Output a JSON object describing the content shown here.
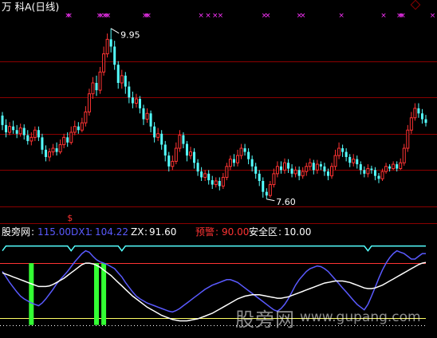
{
  "chart_data": [
    {
      "type": "candlestick",
      "title": "万 科A(日线)",
      "y_range": [
        7.4,
        10.1
      ],
      "annotations": {
        "high_label": "9.95",
        "low_label": "7.60",
        "signal_glyph": "$"
      },
      "colors": {
        "up": "#ff3333",
        "down": "#54ffff",
        "gridline": "#8b0000",
        "marker_x": "#ff33ff",
        "label_white": "#ffffff"
      },
      "candles": [
        [
          8.75,
          8.62,
          8.8,
          8.55
        ],
        [
          8.62,
          8.52,
          8.7,
          8.45
        ],
        [
          8.52,
          8.6,
          8.66,
          8.48
        ],
        [
          8.6,
          8.55,
          8.68,
          8.5
        ],
        [
          8.55,
          8.5,
          8.62,
          8.44
        ],
        [
          8.5,
          8.58,
          8.64,
          8.46
        ],
        [
          8.58,
          8.48,
          8.63,
          8.42
        ],
        [
          8.48,
          8.4,
          8.55,
          8.35
        ],
        [
          8.4,
          8.45,
          8.52,
          8.34
        ],
        [
          8.45,
          8.55,
          8.6,
          8.4
        ],
        [
          8.55,
          8.45,
          8.6,
          8.4
        ],
        [
          8.45,
          8.28,
          8.5,
          8.22
        ],
        [
          8.28,
          8.18,
          8.34,
          8.12
        ],
        [
          8.18,
          8.25,
          8.3,
          8.12
        ],
        [
          8.25,
          8.3,
          8.36,
          8.2
        ],
        [
          8.3,
          8.25,
          8.38,
          8.2
        ],
        [
          8.25,
          8.35,
          8.42,
          8.22
        ],
        [
          8.35,
          8.45,
          8.5,
          8.3
        ],
        [
          8.45,
          8.38,
          8.52,
          8.32
        ],
        [
          8.38,
          8.52,
          8.6,
          8.35
        ],
        [
          8.52,
          8.6,
          8.68,
          8.48
        ],
        [
          8.6,
          8.55,
          8.66,
          8.5
        ],
        [
          8.55,
          8.65,
          8.72,
          8.52
        ],
        [
          8.65,
          8.8,
          8.88,
          8.6
        ],
        [
          8.8,
          9.05,
          9.12,
          8.75
        ],
        [
          9.05,
          9.2,
          9.28,
          8.98
        ],
        [
          9.2,
          9.1,
          9.3,
          9.02
        ],
        [
          9.1,
          9.35,
          9.42,
          9.05
        ],
        [
          9.35,
          9.6,
          9.7,
          9.3
        ],
        [
          9.6,
          9.8,
          9.88,
          9.55
        ],
        [
          9.8,
          9.7,
          9.95,
          9.62
        ],
        [
          9.7,
          9.45,
          9.78,
          9.38
        ],
        [
          9.45,
          9.2,
          9.5,
          9.12
        ],
        [
          9.2,
          9.3,
          9.38,
          9.12
        ],
        [
          9.3,
          9.15,
          9.35,
          9.05
        ],
        [
          9.15,
          9.0,
          9.22,
          8.92
        ],
        [
          9.0,
          8.92,
          9.08,
          8.85
        ],
        [
          8.92,
          8.98,
          9.05,
          8.86
        ],
        [
          8.98,
          8.85,
          9.02,
          8.78
        ],
        [
          8.85,
          8.7,
          8.9,
          8.62
        ],
        [
          8.7,
          8.78,
          8.85,
          8.65
        ],
        [
          8.78,
          8.6,
          8.82,
          8.52
        ],
        [
          8.6,
          8.45,
          8.66,
          8.38
        ],
        [
          8.45,
          8.5,
          8.58,
          8.4
        ],
        [
          8.5,
          8.35,
          8.55,
          8.28
        ],
        [
          8.35,
          8.2,
          8.4,
          8.12
        ],
        [
          8.2,
          8.05,
          8.25,
          7.98
        ],
        [
          8.05,
          8.12,
          8.2,
          8.0
        ],
        [
          8.12,
          8.3,
          8.38,
          8.08
        ],
        [
          8.3,
          8.48,
          8.55,
          8.25
        ],
        [
          8.48,
          8.36,
          8.52,
          8.3
        ],
        [
          8.36,
          8.2,
          8.4,
          8.12
        ],
        [
          8.2,
          8.25,
          8.32,
          8.15
        ],
        [
          8.25,
          8.1,
          8.3,
          8.02
        ],
        [
          8.1,
          7.98,
          8.15,
          7.92
        ],
        [
          7.98,
          7.9,
          8.04,
          7.85
        ],
        [
          7.9,
          7.95,
          8.0,
          7.85
        ],
        [
          7.95,
          7.86,
          8.0,
          7.8
        ],
        [
          7.86,
          7.8,
          7.92,
          7.74
        ],
        [
          7.8,
          7.85,
          7.9,
          7.76
        ],
        [
          7.85,
          7.78,
          7.9,
          7.72
        ],
        [
          7.78,
          7.9,
          7.96,
          7.74
        ],
        [
          7.9,
          8.05,
          8.1,
          7.86
        ],
        [
          8.05,
          8.15,
          8.2,
          8.0
        ],
        [
          8.15,
          8.1,
          8.22,
          8.05
        ],
        [
          8.1,
          8.2,
          8.28,
          8.05
        ],
        [
          8.2,
          8.3,
          8.36,
          8.15
        ],
        [
          8.3,
          8.25,
          8.36,
          8.2
        ],
        [
          8.25,
          8.15,
          8.3,
          8.08
        ],
        [
          8.15,
          8.05,
          8.2,
          7.98
        ],
        [
          8.05,
          7.95,
          8.1,
          7.88
        ],
        [
          7.95,
          7.85,
          8.0,
          7.78
        ],
        [
          7.85,
          7.7,
          7.9,
          7.62
        ],
        [
          7.7,
          7.65,
          7.75,
          7.6
        ],
        [
          7.65,
          7.8,
          7.85,
          7.62
        ],
        [
          7.8,
          7.95,
          8.02,
          7.76
        ],
        [
          7.95,
          8.05,
          8.12,
          7.9
        ],
        [
          8.05,
          8.0,
          8.12,
          7.95
        ],
        [
          8.0,
          8.1,
          8.16,
          7.95
        ],
        [
          8.1,
          8.02,
          8.15,
          7.96
        ],
        [
          8.02,
          7.95,
          8.08,
          7.9
        ],
        [
          7.95,
          8.0,
          8.05,
          7.9
        ],
        [
          8.0,
          7.92,
          8.05,
          7.86
        ],
        [
          7.92,
          7.98,
          8.04,
          7.88
        ],
        [
          7.98,
          8.05,
          8.1,
          7.92
        ],
        [
          8.05,
          8.1,
          8.16,
          8.0
        ],
        [
          8.1,
          8.0,
          8.14,
          7.94
        ],
        [
          8.0,
          8.08,
          8.14,
          7.95
        ],
        [
          8.08,
          8.05,
          8.12,
          8.0
        ],
        [
          8.05,
          7.98,
          8.1,
          7.92
        ],
        [
          7.98,
          7.92,
          8.02,
          7.86
        ],
        [
          7.92,
          8.05,
          8.1,
          7.88
        ],
        [
          8.05,
          8.2,
          8.28,
          8.0
        ],
        [
          8.2,
          8.3,
          8.38,
          8.15
        ],
        [
          8.3,
          8.25,
          8.35,
          8.18
        ],
        [
          8.25,
          8.18,
          8.3,
          8.12
        ],
        [
          8.18,
          8.1,
          8.22,
          8.04
        ],
        [
          8.1,
          8.15,
          8.22,
          8.05
        ],
        [
          8.15,
          8.08,
          8.2,
          8.02
        ],
        [
          8.08,
          8.0,
          8.12,
          7.94
        ],
        [
          8.0,
          7.95,
          8.05,
          7.9
        ],
        [
          7.95,
          8.02,
          8.08,
          7.9
        ],
        [
          8.02,
          8.0,
          8.06,
          7.95
        ],
        [
          8.0,
          7.92,
          8.04,
          7.86
        ],
        [
          7.92,
          7.88,
          7.96,
          7.82
        ],
        [
          7.88,
          7.98,
          8.02,
          7.85
        ],
        [
          7.98,
          8.05,
          8.1,
          7.95
        ],
        [
          8.05,
          8.02,
          8.08,
          7.98
        ],
        [
          8.02,
          8.08,
          8.12,
          8.0
        ],
        [
          8.08,
          8.02,
          8.12,
          7.98
        ],
        [
          8.02,
          8.1,
          8.16,
          8.0
        ],
        [
          8.1,
          8.3,
          8.36,
          8.06
        ],
        [
          8.3,
          8.55,
          8.62,
          8.25
        ],
        [
          8.55,
          8.72,
          8.8,
          8.5
        ],
        [
          8.72,
          8.85,
          8.92,
          8.68
        ],
        [
          8.85,
          8.78,
          8.92,
          8.72
        ],
        [
          8.78,
          8.7,
          8.84,
          8.64
        ],
        [
          8.7,
          8.65,
          8.76,
          8.6
        ]
      ]
    },
    {
      "type": "line",
      "y_range": [
        -12,
        125
      ],
      "legend": [
        {
          "name": "股旁网",
          "value": "115.00",
          "color": "#ffffff"
        },
        {
          "name": "DX1",
          "value": "104.22",
          "color": "#5a5aff"
        },
        {
          "name": "ZX",
          "value": "91.60",
          "color": "#ffffff"
        },
        {
          "name": "预警",
          "value": "90.00",
          "color": "#ff3333"
        },
        {
          "name": "安全区",
          "value": "10.00",
          "color": "#ffffff"
        }
      ],
      "reference_lines": [
        {
          "name": "股旁网",
          "value": 115,
          "color": "#54ffff"
        },
        {
          "name": "预警",
          "value": 90,
          "color": "#ff3333"
        },
        {
          "name": "安全区",
          "value": 10,
          "color": "#ffff66"
        }
      ],
      "series": [
        {
          "name": "DX1",
          "color": "#5a5aff",
          "values": [
            78,
            70,
            62,
            55,
            48,
            42,
            38,
            35,
            32,
            30,
            28,
            32,
            38,
            45,
            52,
            60,
            66,
            72,
            78,
            85,
            92,
            98,
            104,
            108,
            106,
            100,
            95,
            92,
            90,
            88,
            85,
            82,
            76,
            70,
            62,
            55,
            48,
            42,
            38,
            35,
            32,
            30,
            28,
            26,
            24,
            22,
            20,
            19,
            21,
            24,
            28,
            32,
            36,
            40,
            44,
            48,
            52,
            55,
            58,
            60,
            62,
            64,
            66,
            66,
            64,
            62,
            58,
            54,
            50,
            46,
            42,
            38,
            34,
            30,
            26,
            22,
            20,
            24,
            30,
            38,
            48,
            58,
            66,
            72,
            78,
            82,
            84,
            86,
            85,
            82,
            78,
            72,
            66,
            60,
            54,
            48,
            42,
            36,
            30,
            26,
            22,
            30,
            42,
            55,
            68,
            80,
            90,
            98,
            104,
            108,
            106,
            104,
            100,
            96,
            96,
            100,
            104,
            104
          ]
        },
        {
          "name": "ZX",
          "color": "#ffffff",
          "values": [
            76,
            74,
            72,
            70,
            68,
            66,
            64,
            62,
            60,
            58,
            56,
            56,
            56,
            57,
            59,
            62,
            65,
            68,
            72,
            76,
            80,
            84,
            88,
            90,
            90,
            89,
            87,
            84,
            80,
            76,
            72,
            67,
            62,
            57,
            52,
            47,
            42,
            38,
            34,
            30,
            26,
            23,
            20,
            17,
            14,
            12,
            10,
            8,
            7,
            6,
            6,
            6,
            7,
            8,
            9,
            11,
            13,
            15,
            17,
            20,
            23,
            26,
            29,
            32,
            35,
            38,
            40,
            42,
            43,
            44,
            44,
            44,
            43,
            42,
            41,
            40,
            39,
            39,
            40,
            41,
            43,
            45,
            47,
            49,
            51,
            53,
            55,
            57,
            59,
            61,
            62,
            63,
            64,
            64,
            64,
            63,
            62,
            60,
            58,
            56,
            54,
            53,
            53,
            54,
            56,
            58,
            61,
            64,
            67,
            70,
            73,
            76,
            79,
            82,
            85,
            88,
            90,
            91
          ]
        },
        {
          "name": "股旁网",
          "color": "#54ffff",
          "values": [
            108,
            115,
            115,
            115,
            115,
            115,
            115,
            115,
            115,
            115,
            115,
            115,
            115,
            115,
            115,
            115,
            115,
            115,
            115,
            108,
            115,
            115,
            115,
            115,
            115,
            115,
            115,
            115,
            115,
            115,
            115,
            115,
            115,
            108,
            115,
            115,
            115,
            115,
            115,
            115,
            115,
            115,
            115,
            115,
            115,
            115,
            115,
            115,
            115,
            115,
            115,
            115,
            115,
            115,
            115,
            115,
            115,
            115,
            115,
            115,
            115,
            115,
            115,
            115,
            115,
            115,
            115,
            115,
            115,
            115,
            115,
            115,
            115,
            115,
            115,
            115,
            115,
            115,
            115,
            115,
            115,
            115,
            115,
            115,
            115,
            115,
            115,
            115,
            115,
            115,
            115,
            115,
            115,
            115,
            115,
            115,
            115,
            115,
            115,
            115,
            115,
            108,
            115,
            115,
            115,
            115,
            115,
            115,
            115,
            115,
            115,
            115,
            115,
            115,
            115,
            115,
            115,
            115
          ]
        }
      ],
      "signal_bars": [
        {
          "index": 8,
          "value": 90
        },
        {
          "index": 26,
          "value": 90
        },
        {
          "index": 28,
          "value": 90
        }
      ]
    }
  ]
}
